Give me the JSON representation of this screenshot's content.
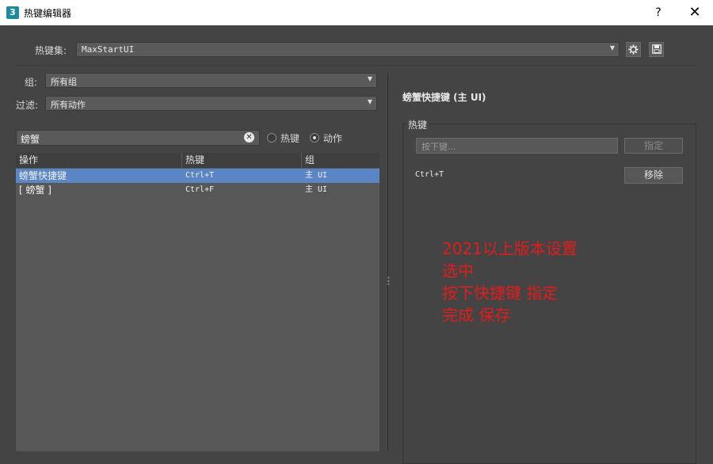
{
  "window": {
    "title": "热键编辑器",
    "icon_text": "3",
    "help_label": "?",
    "close_label": "✕"
  },
  "hotkey_set": {
    "label": "热键集:",
    "value": "MaxStartUI",
    "settings_icon": "gear-icon",
    "save_icon": "save-icon"
  },
  "filters": {
    "group_label": "组:",
    "group_value": "所有组",
    "filter_label": "过滤:",
    "filter_value": "所有动作"
  },
  "search": {
    "value": "螃蟹",
    "mode_hotkey": "热键",
    "mode_action": "动作",
    "selected_mode": "动作"
  },
  "table": {
    "columns": [
      "操作",
      "热键",
      "组"
    ],
    "rows": [
      {
        "action": "螃蟹快捷键",
        "hotkey": "Ctrl+T",
        "group": "主 UI",
        "selected": true
      },
      {
        "action": "[ 螃蟹 ]",
        "hotkey": "Ctrl+F",
        "group": "主 UI",
        "selected": false
      }
    ]
  },
  "detail": {
    "title": "螃蟹快捷键 (主 UI)",
    "group_label": "热键",
    "input_placeholder": "按下键...",
    "assign_label": "指定",
    "assigned_hotkey": "Ctrl+T",
    "remove_label": "移除"
  },
  "annotation": {
    "lines": [
      "2021以上版本设置",
      "选中",
      "按下快捷键 指定",
      "完成 保存"
    ],
    "color": "#e21b1b"
  }
}
